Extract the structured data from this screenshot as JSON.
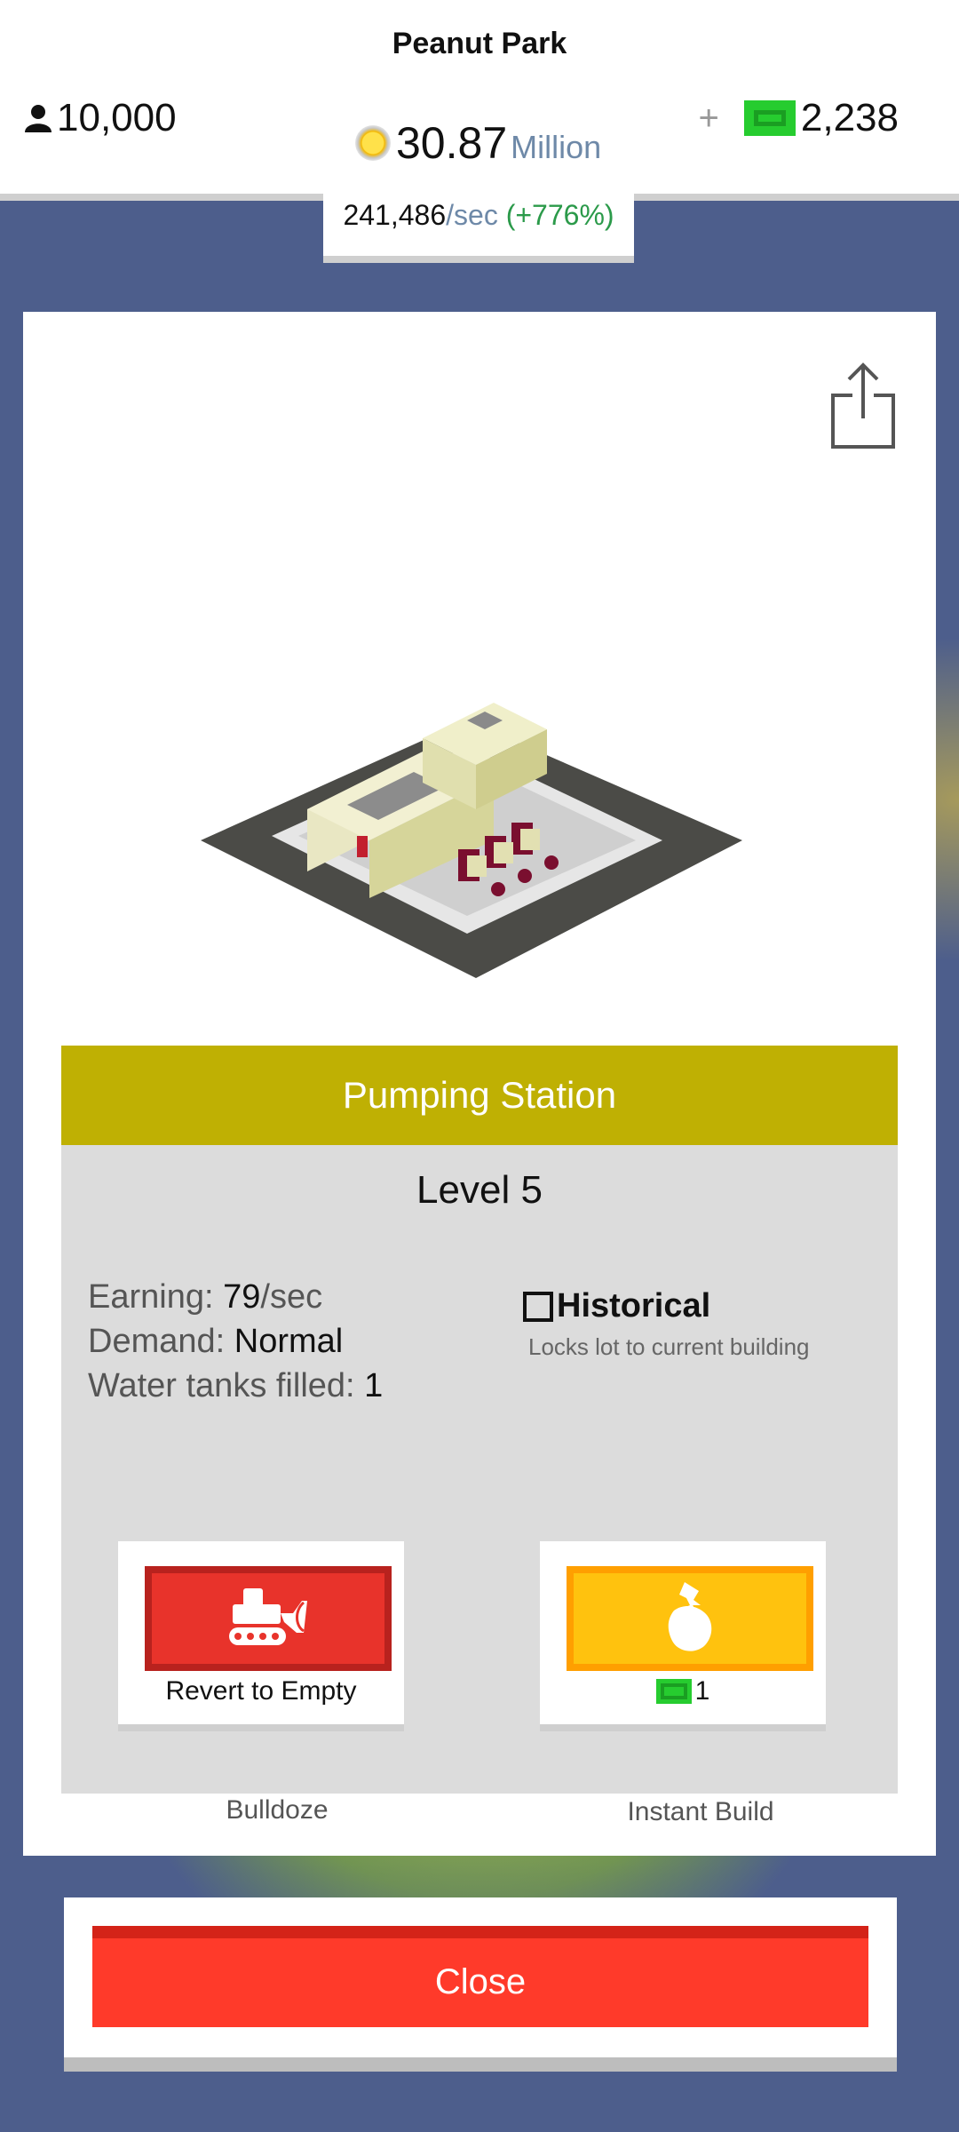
{
  "header": {
    "city_name": "Peanut Park",
    "population": "10,000",
    "coins_value": "30.87",
    "coins_unit": "Million",
    "income_value": "241,486",
    "income_per": "/sec",
    "income_percent": "(+776%)",
    "plus": "+",
    "cash": "2,238"
  },
  "building": {
    "name": "Pumping Station",
    "level": "Level 5",
    "earning_label": "Earning:",
    "earning_value": "79",
    "earning_unit": "/sec",
    "demand_label": "Demand:",
    "demand_value": "Normal",
    "water_label": "Water tanks filled:",
    "water_value": "1",
    "historical_label": "Historical",
    "historical_sub": "Locks lot to current building",
    "historical_checked": false
  },
  "actions": {
    "bulldoze_label": "Bulldoze",
    "bulldoze_caption": "Revert to Empty",
    "instant_label": "Instant Build",
    "instant_cost": "1"
  },
  "footer": {
    "close_label": "Close"
  },
  "colors": {
    "title_bar": "#bfb003",
    "bulldoze": "#e8332b",
    "instant": "#ffc20e",
    "close": "#ff3a2a",
    "cash": "#26cc2f"
  }
}
